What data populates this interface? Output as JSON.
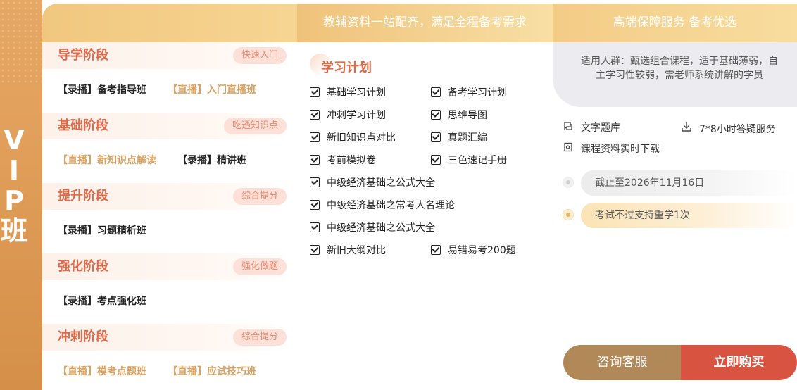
{
  "vip": {
    "label_chars": [
      "V",
      "I",
      "P",
      "班"
    ]
  },
  "header": {
    "middle_title": "教辅资料一站配齐，满足全程备考需求",
    "right_title": "高端保障服务 备考优选"
  },
  "stages": [
    {
      "title": "导学阶段",
      "tag": "快速入门",
      "items": [
        {
          "text": "【录播】备考指导班",
          "kind": "recorded"
        },
        {
          "text": "【直播】入门直播班",
          "kind": "live"
        }
      ]
    },
    {
      "title": "基础阶段",
      "tag": "吃透知识点",
      "items": [
        {
          "text": "【直播】新知识点解读",
          "kind": "live"
        },
        {
          "text": "【录播】精讲班",
          "kind": "recorded"
        }
      ]
    },
    {
      "title": "提升阶段",
      "tag": "综合提分",
      "items": [
        {
          "text": "【录播】习题精析班",
          "kind": "recorded"
        }
      ]
    },
    {
      "title": "强化阶段",
      "tag": "强化做题",
      "items": [
        {
          "text": "【录播】考点强化班",
          "kind": "recorded"
        }
      ]
    },
    {
      "title": "冲刺阶段",
      "tag": "综合提分",
      "items": [
        {
          "text": "【直播】模考点题班",
          "kind": "live"
        },
        {
          "text": "【直播】应试技巧班",
          "kind": "live"
        }
      ]
    }
  ],
  "study_plan": {
    "title": "学习计划",
    "items": [
      "基础学习计划",
      "备考学习计划",
      "冲刺学习计划",
      "思维导图",
      "新旧知识点对比",
      "真题汇编",
      "考前模拟卷",
      "三色速记手册",
      "中级经济基础之公式大全",
      "中级经济基础之常考人名理论",
      "中级经济基础之公式大全",
      "新旧大纲对比",
      "易错易考200题"
    ]
  },
  "service": {
    "audience": "适用人群：甄选组合课程，适于基础薄弱，自主学习性较弱，需老师系统讲解的学员",
    "features": [
      {
        "icon": "question-bank-icon",
        "text": "文字题库"
      },
      {
        "icon": "download-icon",
        "text": "7*8小时答疑服务"
      },
      {
        "icon": "document-icon",
        "text": "课程资料实时下载"
      }
    ],
    "validity": "截止至2026年11月16日",
    "guarantee": "考试不过支持重学1次",
    "consult_label": "咨询客服",
    "buy_label": "立即购买"
  },
  "colors": {
    "accent_red": "#d85440",
    "stage_title": "#e06a4a",
    "live_gold": "#d8a061",
    "consult_brown": "#b18858",
    "vip_orange": "#dd9b55"
  }
}
